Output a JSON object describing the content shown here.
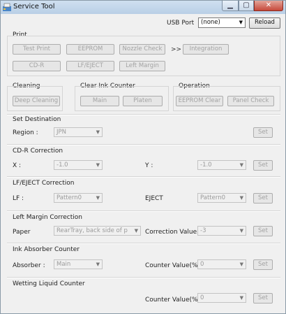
{
  "window": {
    "title": "Service Tool"
  },
  "usb": {
    "label": "USB Port",
    "value": "(none)",
    "reload": "Reload"
  },
  "print": {
    "label": "Print",
    "test_print": "Test Print",
    "eeprom": "EEPROM",
    "nozzle_check": "Nozzle Check",
    "arrow": ">>",
    "integration": "Integration",
    "cd_r": "CD-R",
    "lf_eject": "LF/EJECT",
    "left_margin": "Left Margin"
  },
  "cleaning": {
    "label": "Cleaning",
    "deep_cleaning": "Deep Cleaning"
  },
  "clear_ink": {
    "label": "Clear Ink Counter",
    "main": "Main",
    "platen": "Platen"
  },
  "operation": {
    "label": "Operation",
    "eeprom_clear": "EEPROM Clear",
    "panel_check": "Panel Check"
  },
  "destination": {
    "label": "Set Destination",
    "region_label": "Region :",
    "region_value": "JPN",
    "set": "Set"
  },
  "cdr_correction": {
    "label": "CD-R Correction",
    "x_label": "X :",
    "x_value": "-1.0",
    "y_label": "Y :",
    "y_value": "-1.0",
    "set": "Set"
  },
  "lf_eject_correction": {
    "label": "LF/EJECT Correction",
    "lf_label": "LF :",
    "lf_value": "Pattern0",
    "eject_label": "EJECT",
    "eject_value": "Pattern0",
    "set": "Set"
  },
  "left_margin_correction": {
    "label": "Left Margin Correction",
    "paper_label": "Paper",
    "paper_value": "RearTray, back side of p",
    "corr_label": "Correction Value",
    "corr_value": "-3",
    "set": "Set"
  },
  "ink_absorber": {
    "label": "Ink Absorber Counter",
    "absorber_label": "Absorber :",
    "absorber_value": "Main",
    "counter_label": "Counter Value(%)",
    "counter_value": "0",
    "set": "Set"
  },
  "wetting": {
    "label": "Wetting Liquid Counter",
    "counter_label": "Counter Value(%)",
    "counter_value": "0",
    "set": "Set"
  }
}
